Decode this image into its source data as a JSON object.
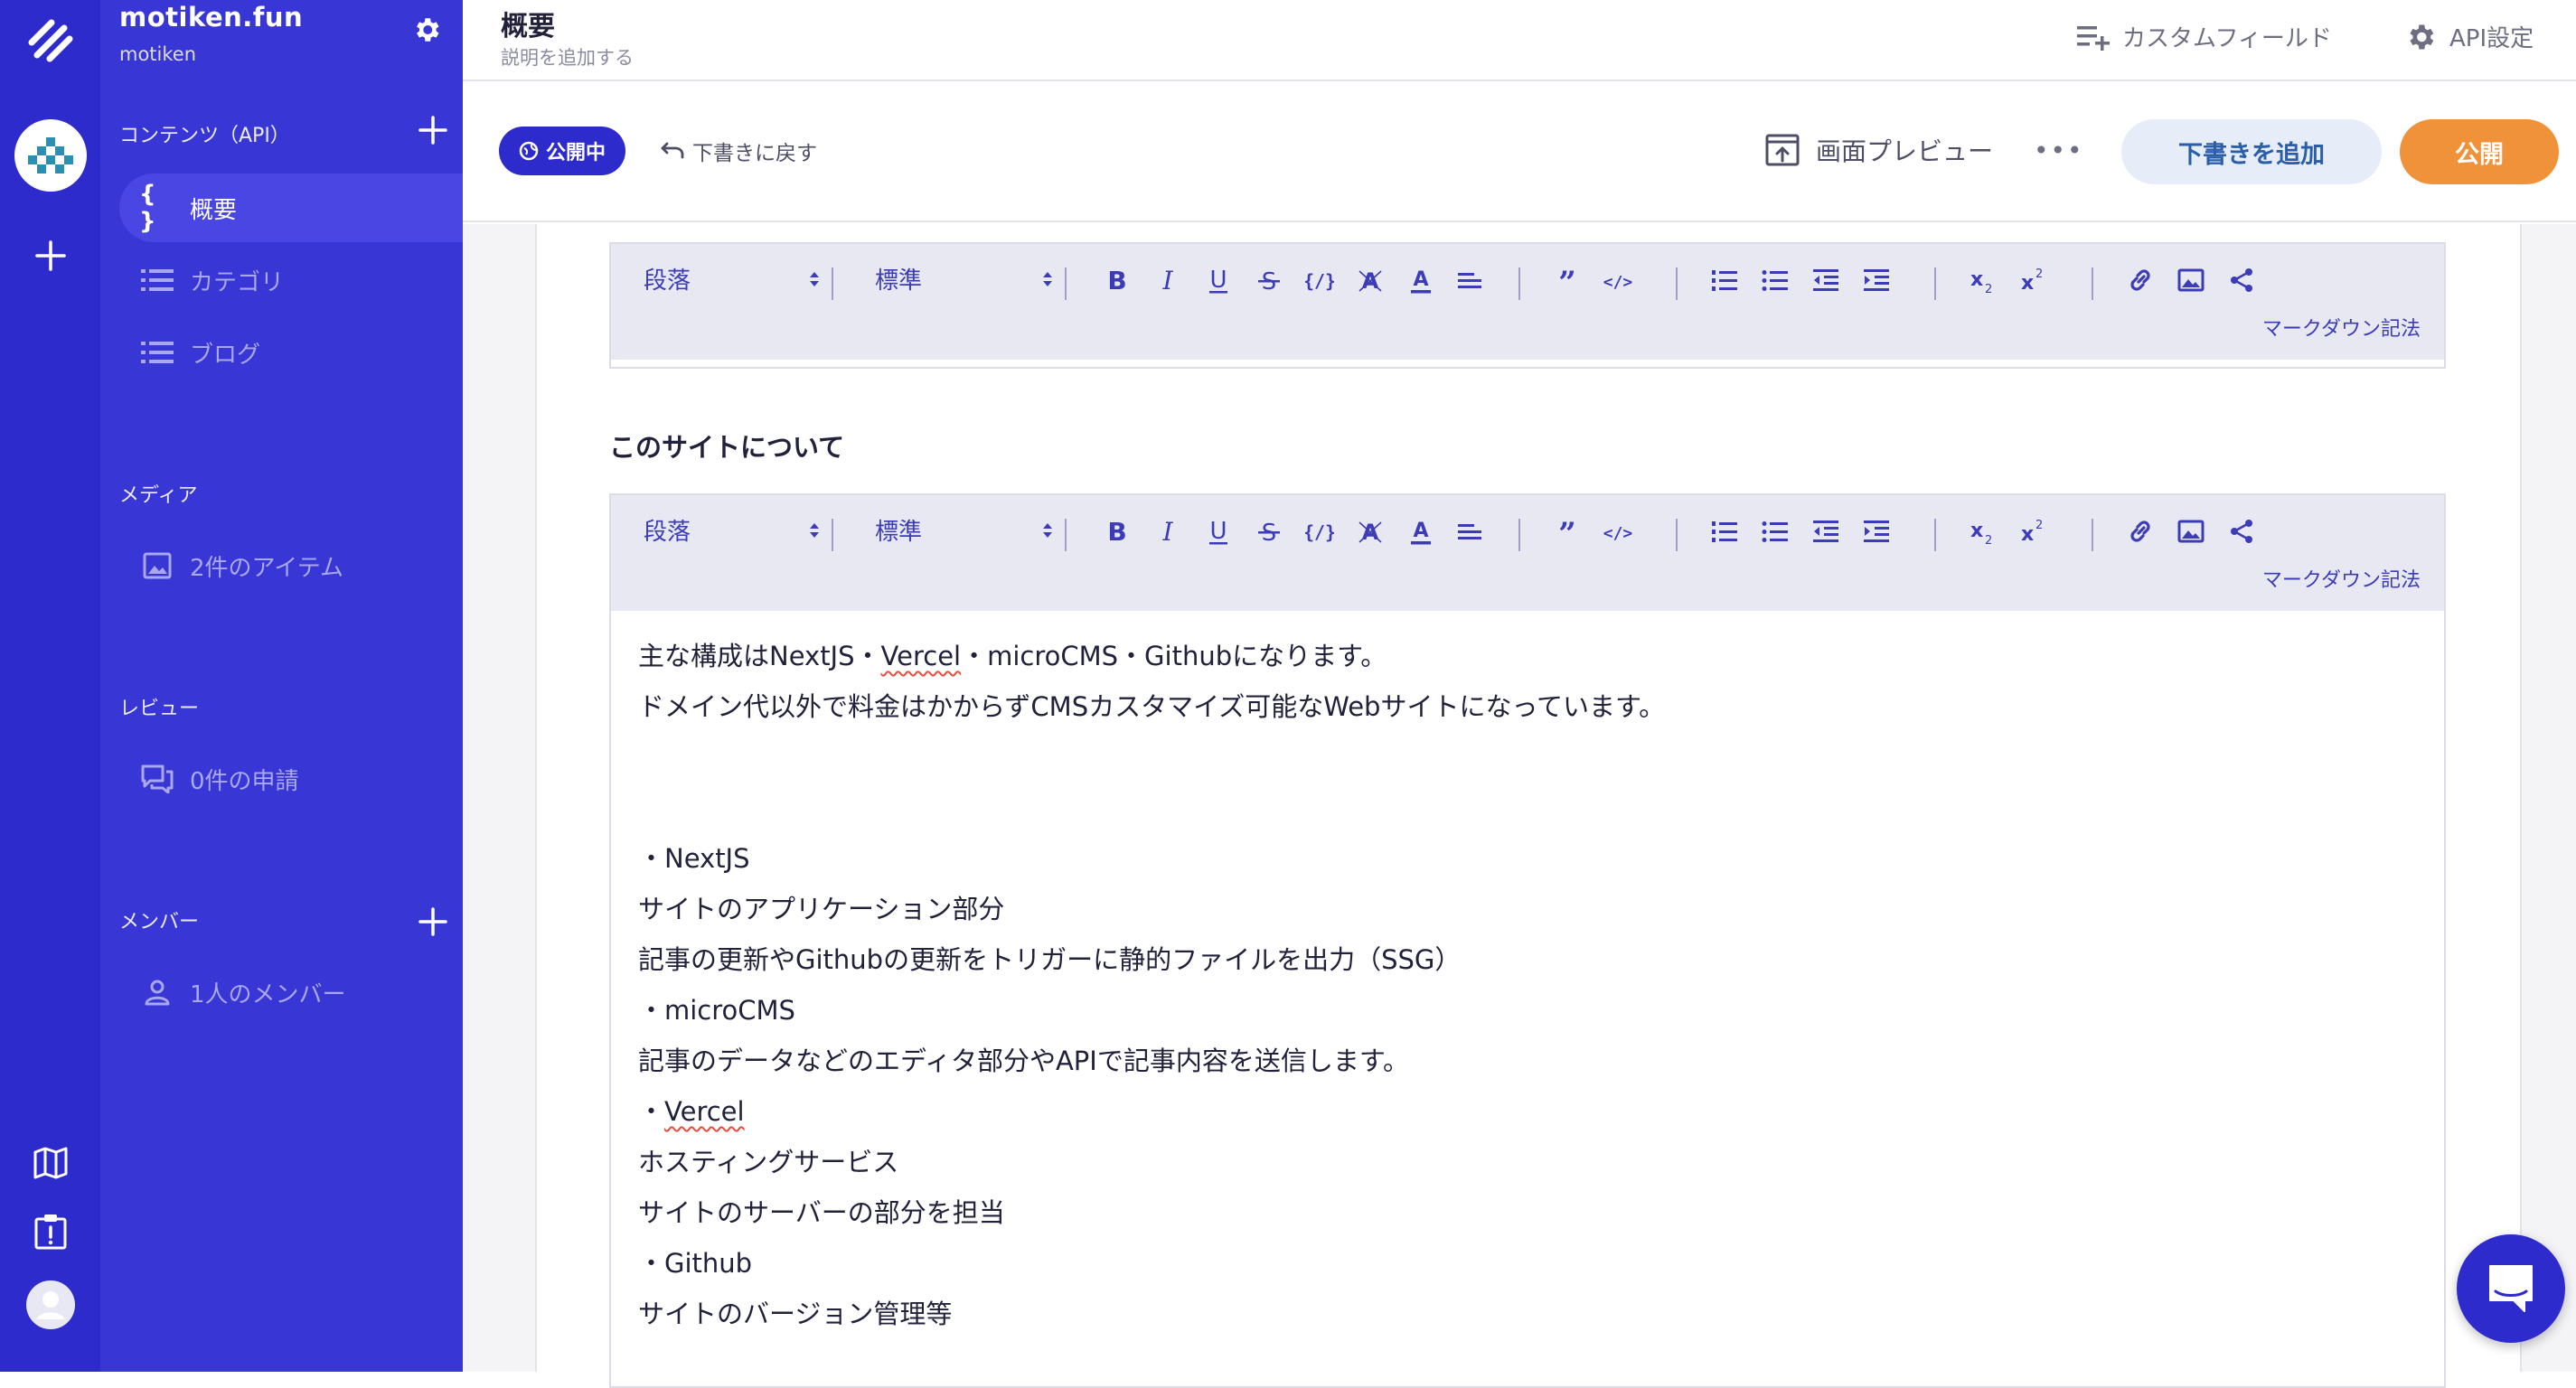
{
  "sidebar": {
    "service_name": "motiken.fun",
    "service_id": "motiken",
    "contents_heading": "コンテンツ（API）",
    "items": [
      {
        "label": "概要",
        "icon": "braces-icon"
      },
      {
        "label": "カテゴリ",
        "icon": "list-icon"
      },
      {
        "label": "ブログ",
        "icon": "list-icon"
      }
    ],
    "media_heading": "メディア",
    "media_item": "2件のアイテム",
    "review_heading": "レビュー",
    "review_item": "0件の申請",
    "members_heading": "メンバー",
    "members_item": "1人のメンバー"
  },
  "header": {
    "title": "概要",
    "description_placeholder": "説明を追加する",
    "custom_field_label": "カスタムフィールド",
    "api_settings_label": "API設定"
  },
  "actions": {
    "status_badge": "公開中",
    "revert_label": "下書きに戻す",
    "preview_label": "画面プレビュー",
    "more_label": "•••",
    "add_draft_label": "下書きを追加",
    "publish_label": "公開"
  },
  "editor": {
    "paragraph_select": "段落",
    "size_select": "標準",
    "markdown_link": "マークダウン記法",
    "section_label": "このサイトについて",
    "lines": [
      "主な構成はNextJS・Vercel・microCMS・Githubになります。",
      "ドメイン代以外で料金はかからずCMSカスタマイズ可能なWebサイトになっています。",
      "",
      "",
      "・NextJS",
      "サイトのアプリケーション部分",
      "記事の更新やGithubの更新をトリガーに静的ファイルを出力（SSG）",
      "・microCMS",
      "記事のデータなどのエディタ部分やAPIで記事内容を送信します。",
      "・Vercel",
      "ホスティングサービス",
      "サイトのサーバーの部分を担当",
      "・Github",
      "サイトのバージョン管理等"
    ]
  },
  "colors": {
    "rail": "#2e2bcc",
    "sidebar": "#3936d6",
    "primary": "#2e2bcc",
    "publish": "#f0923a",
    "draft_button_bg": "#e6ecf8"
  }
}
